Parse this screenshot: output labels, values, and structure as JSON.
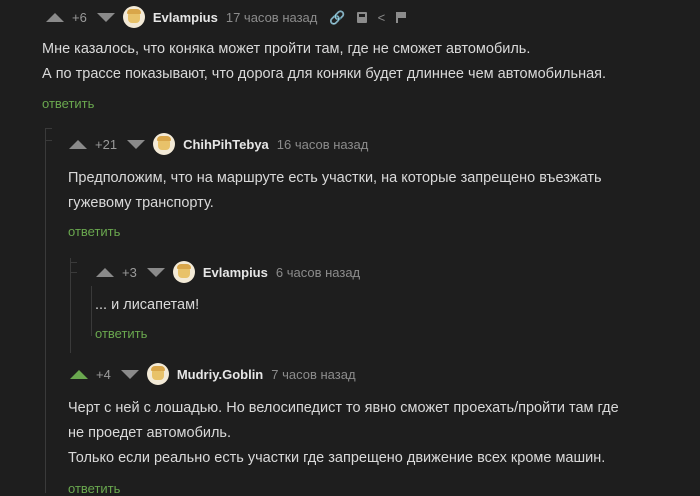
{
  "comments": [
    {
      "rating": "+6",
      "author": "Evlampius",
      "time": "17 часов назад",
      "lines": [
        "Мне казалось, что коняка может пройти там, где не сможет автомобиль.",
        "А по трассе показывают, что дорога для коняки будет длиннее чем автомобильная."
      ],
      "reply": "ответить"
    },
    {
      "rating": "+21",
      "author": "ChihPihTebya",
      "time": "16 часов назад",
      "lines": [
        "Предположим, что на маршруте есть участки, на которые запрещено въезжать",
        "гужевому транспорту."
      ],
      "reply": "ответить"
    },
    {
      "rating": "+3",
      "author": "Evlampius",
      "time": "6 часов назад",
      "lines": [
        "... и лисапетам!"
      ],
      "reply": "ответить"
    },
    {
      "rating": "+4",
      "author": "Mudriy.Goblin",
      "time": "7 часов назад",
      "lines": [
        "Черт с ней с лошадью. Но велосипедист то явно сможет проехать/пройти там где",
        "не проедет автомобиль.",
        "Только если реально есть участки где запрещено движение всех кроме машин."
      ],
      "reply": "ответить"
    }
  ],
  "icons": [
    "link-icon",
    "save-icon",
    "share-icon",
    "report-flag-icon"
  ],
  "colors": {
    "background": "#1e1e1e",
    "accent": "#6aa84f",
    "text": "#d9d9d9",
    "muted": "#8c8c8c"
  }
}
